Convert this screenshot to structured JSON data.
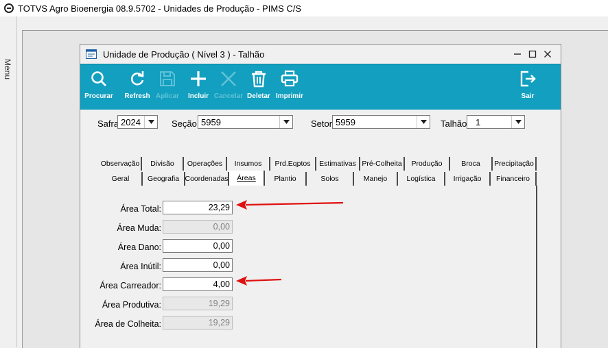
{
  "app": {
    "title": "TOTVS Agro Bioenergia 08.9.5702 - Unidades de Produção - PIMS C/S"
  },
  "side_menu": {
    "label": "Menu"
  },
  "window": {
    "title": "Unidade de Produção ( Nível 3 ) - Talhão"
  },
  "toolbar": {
    "procurar": "Procurar",
    "refresh": "Refresh",
    "aplicar": "Aplicar",
    "incluir": "Incluir",
    "cancelar": "Cancelar",
    "deletar": "Deletar",
    "imprimir": "Imprimir",
    "sair": "Sair"
  },
  "filters": {
    "safra_label": "Safra:",
    "safra_value": "2024",
    "secao_label": "Seção:",
    "secao_value": "5959",
    "setor_label": "Setor:",
    "setor_value": "5959",
    "talhao_label": "Talhão:",
    "talhao_value": "1"
  },
  "tabs": {
    "row1": [
      "Observação",
      "Divisão",
      "Operações",
      "Insumos",
      "Prd.Eqptos",
      "Estimativas",
      "Pré-Colheita",
      "Produção",
      "Broca",
      "Precipitação"
    ],
    "row2": [
      "Geral",
      "Geografia",
      "Coordenadas",
      "Áreas",
      "Plantio",
      "Solos",
      "Manejo",
      "Logística",
      "Irrigação",
      "Financeiro"
    ],
    "active": "Áreas"
  },
  "fields": {
    "area_total": {
      "label": "Área Total:",
      "value": "23,29"
    },
    "area_muda": {
      "label": "Área Muda:",
      "value": "0,00"
    },
    "area_dano": {
      "label": "Área Dano:",
      "value": "0,00"
    },
    "area_inutil": {
      "label": "Área Inútil:",
      "value": "0,00"
    },
    "area_carreador": {
      "label": "Área Carreador:",
      "value": "4,00"
    },
    "area_produtiva": {
      "label": "Área Produtiva:",
      "value": "19,29"
    },
    "area_colheita": {
      "label": "Área de Colheita:",
      "value": "19,29"
    }
  },
  "colors": {
    "toolbar": "#139fbf",
    "annotation_arrow": "#e01010"
  }
}
